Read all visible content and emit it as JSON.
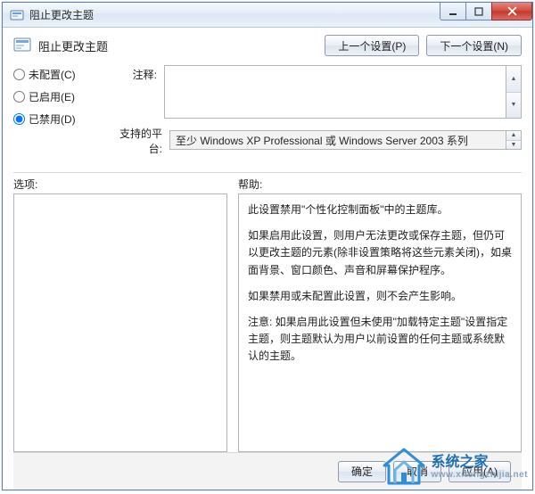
{
  "titlebar": {
    "title": "阻止更改主题"
  },
  "header": {
    "policy_title": "阻止更改主题",
    "prev_button": "上一个设置(P)",
    "next_button": "下一个设置(N)"
  },
  "radios": {
    "not_configured": "未配置(C)",
    "enabled": "已启用(E)",
    "disabled": "已禁用(D)",
    "selected": "disabled"
  },
  "fields": {
    "comment_label": "注释:",
    "comment_value": "",
    "platform_label": "支持的平台:",
    "platform_value": "至少 Windows XP Professional 或 Windows Server 2003 系列"
  },
  "columns": {
    "options_label": "选项:",
    "help_label": "帮助:"
  },
  "help": {
    "p1": "此设置禁用\"个性化控制面板\"中的主题库。",
    "p2": "如果启用此设置，则用户无法更改或保存主题，但仍可以更改主题的元素(除非设置策略将这些元素关闭)，如桌面背景、窗口颜色、声音和屏幕保护程序。",
    "p3": "如果禁用或未配置此设置，则不会产生影响。",
    "p4": "注意: 如果启用此设置但未使用\"加载特定主题\"设置指定主题，则主题默认为用户以前设置的任何主题或系统默认的主题。"
  },
  "buttons": {
    "ok": "确定",
    "cancel": "取消",
    "apply": "应用(A)"
  },
  "watermark": {
    "main": "系统之家",
    "sub": "www.xitongzhijia.net"
  }
}
